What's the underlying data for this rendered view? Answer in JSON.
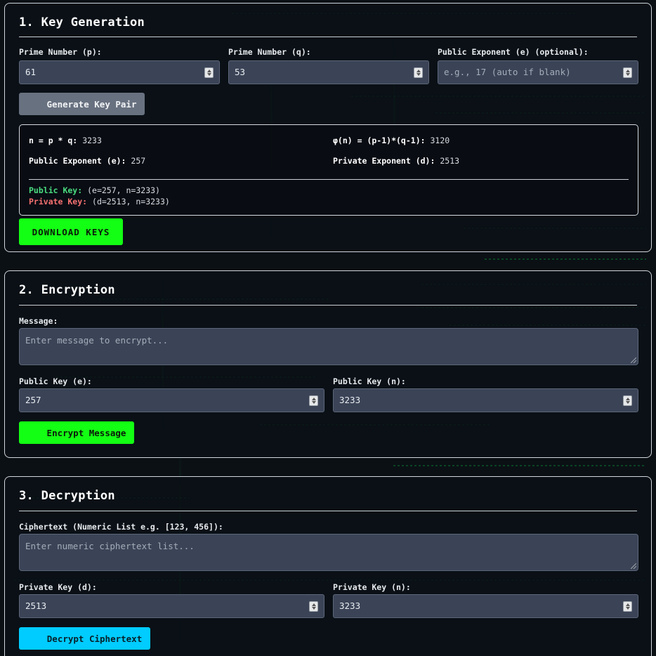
{
  "keygen": {
    "title": "1. Key Generation",
    "p_label": "Prime Number (p):",
    "p_value": "61",
    "q_label": "Prime Number (q):",
    "q_value": "53",
    "e_label": "Public Exponent (e) (optional):",
    "e_placeholder": "e.g., 17 (auto if blank)",
    "generate_button": "Generate Key Pair",
    "results": {
      "n_label": "n = p * q:",
      "n_value": "3233",
      "phi_label": "φ(n) = (p-1)*(q-1):",
      "phi_value": "3120",
      "e_label": "Public Exponent (e):",
      "e_value": "257",
      "d_label": "Private Exponent (d):",
      "d_value": "2513",
      "public_key_label": "Public Key:",
      "public_key_value": "(e=257, n=3233)",
      "private_key_label": "Private Key:",
      "private_key_value": "(d=2513, n=3233)"
    },
    "download_button": "DOWNLOAD KEYS"
  },
  "encryption": {
    "title": "2. Encryption",
    "message_label": "Message:",
    "message_placeholder": "Enter message to encrypt...",
    "e_label": "Public Key (e):",
    "e_value": "257",
    "n_label": "Public Key (n):",
    "n_value": "3233",
    "encrypt_button": "Encrypt Message"
  },
  "decryption": {
    "title": "3. Decryption",
    "cipher_label": "Ciphertext (Numeric List e.g. [123, 456]):",
    "cipher_placeholder": "Enter numeric ciphertext list...",
    "d_label": "Private Key (d):",
    "d_value": "2513",
    "n_label": "Private Key (n):",
    "n_value": "3233",
    "decrypt_button": "Decrypt Ciphertext"
  },
  "colors": {
    "accent_green": "#13ff13",
    "accent_cyan": "#00ccff",
    "public_key_green": "#4ade80",
    "private_key_red": "#f87171"
  }
}
